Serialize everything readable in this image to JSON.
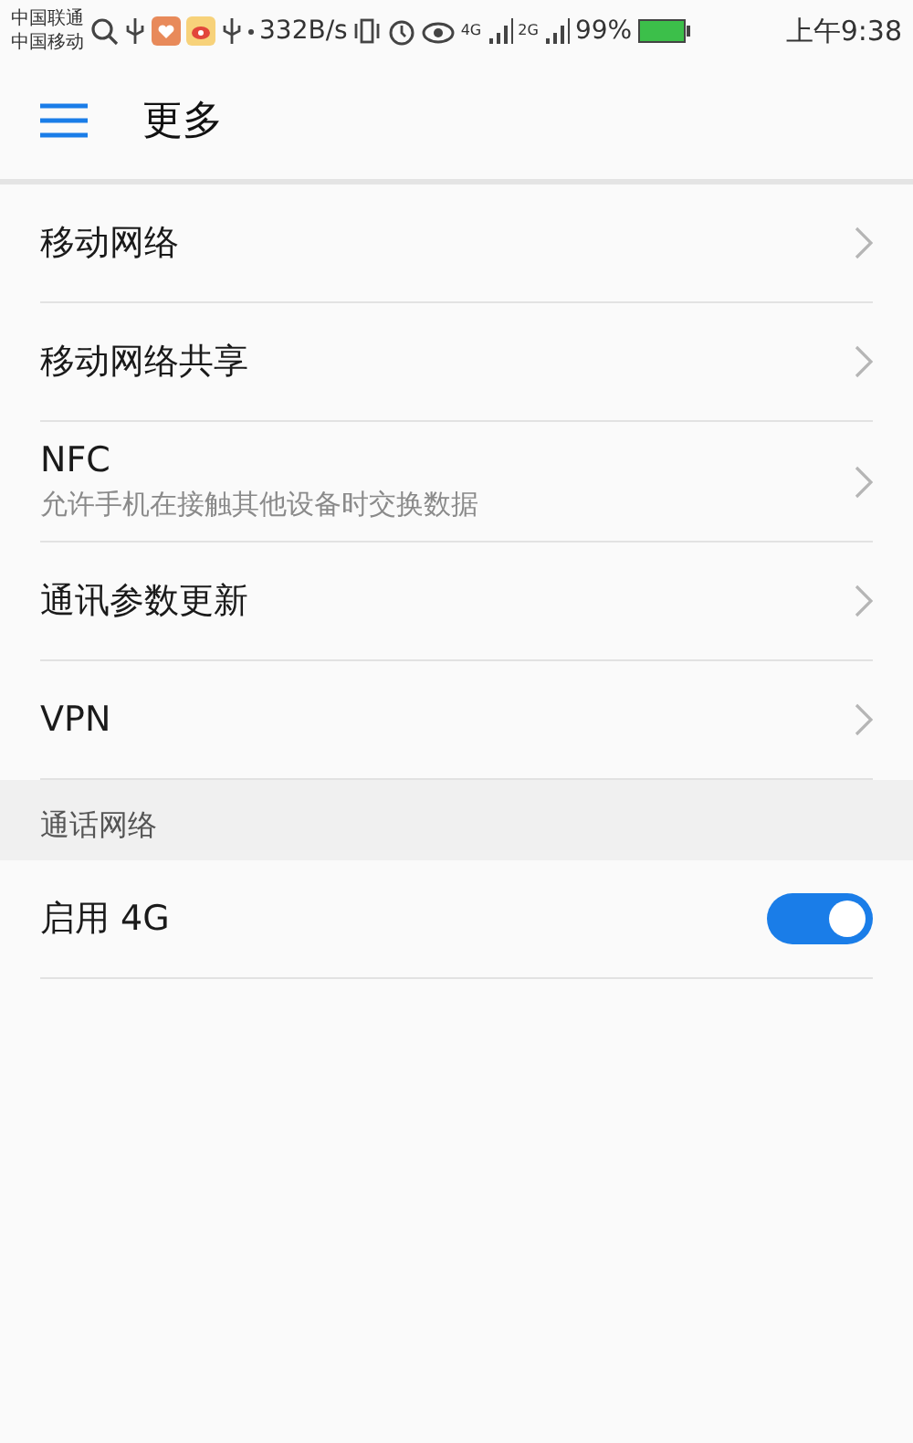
{
  "status_bar": {
    "carriers": [
      "中国联通",
      "中国移动"
    ],
    "speed": "332B/s",
    "network_tags": [
      "4G",
      "2G"
    ],
    "battery": "99%",
    "time": "上午9:38"
  },
  "header": {
    "title": "更多"
  },
  "items": [
    {
      "kind": "link",
      "label": "移动网络"
    },
    {
      "kind": "link",
      "label": "移动网络共享"
    },
    {
      "kind": "link",
      "label": "NFC",
      "subtitle": "允许手机在接触其他设备时交换数据"
    },
    {
      "kind": "link",
      "label": "通讯参数更新"
    },
    {
      "kind": "link",
      "label": "VPN"
    },
    {
      "kind": "section",
      "label": "通话网络"
    },
    {
      "kind": "switch",
      "label": "启用 4G",
      "on": true
    }
  ]
}
